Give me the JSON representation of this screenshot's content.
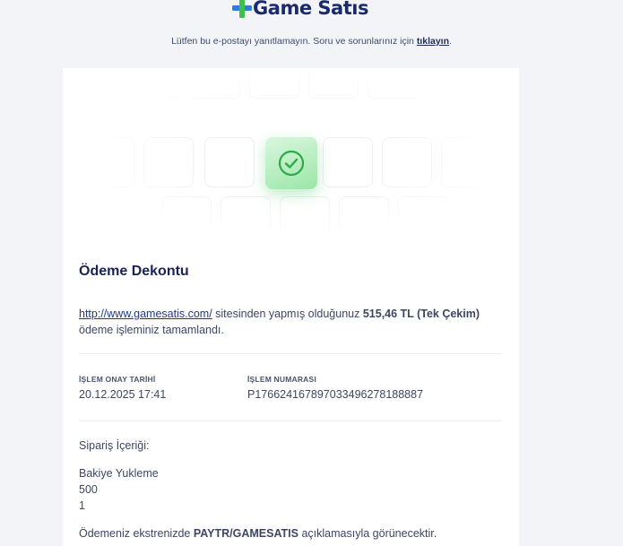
{
  "logo": {
    "game": "Game",
    "satis": "Satıs"
  },
  "notice": {
    "text": "Lütfen bu e-postayı yanıtlamayın. Soru ve sorunlarınız için ",
    "link": "tıklayın",
    "suffix": "."
  },
  "receipt": {
    "title": "Ödeme Dekontu",
    "site_link": "http://www.gamesatis.com/",
    "message_part1": " sitesinden yapmış olduğunuz ",
    "amount": "515,46 TL (Tek Çekim)",
    "message_part2": " ödeme işleminiz tamamlandı.",
    "approval_date_label": "İŞLEM ONAY TARİHİ",
    "approval_date_value": "20.12.2025 17:41",
    "transaction_number_label": "İŞLEM NUMARASI",
    "transaction_number_value": "P176624167897033496278188887",
    "order_contents_label": "Sipariş İçeriği:",
    "order_item_name": "Bakiye Yukleme",
    "order_item_amount": "500",
    "order_item_qty": "1",
    "statement_part1": "Ödemeniz ekstrenizde ",
    "statement_brand": "PAYTR/GAMESATIS",
    "statement_part2": " açıklamasıyla görünecektir."
  },
  "colors": {
    "logo_plus_green": "#3cc24a",
    "logo_plus_blue": "#2f7de1",
    "check_green": "#2fa84a",
    "title_navy": "#1a2356"
  },
  "icons": {
    "logo": "plus-cross-icon",
    "success": "check-circle-icon"
  }
}
